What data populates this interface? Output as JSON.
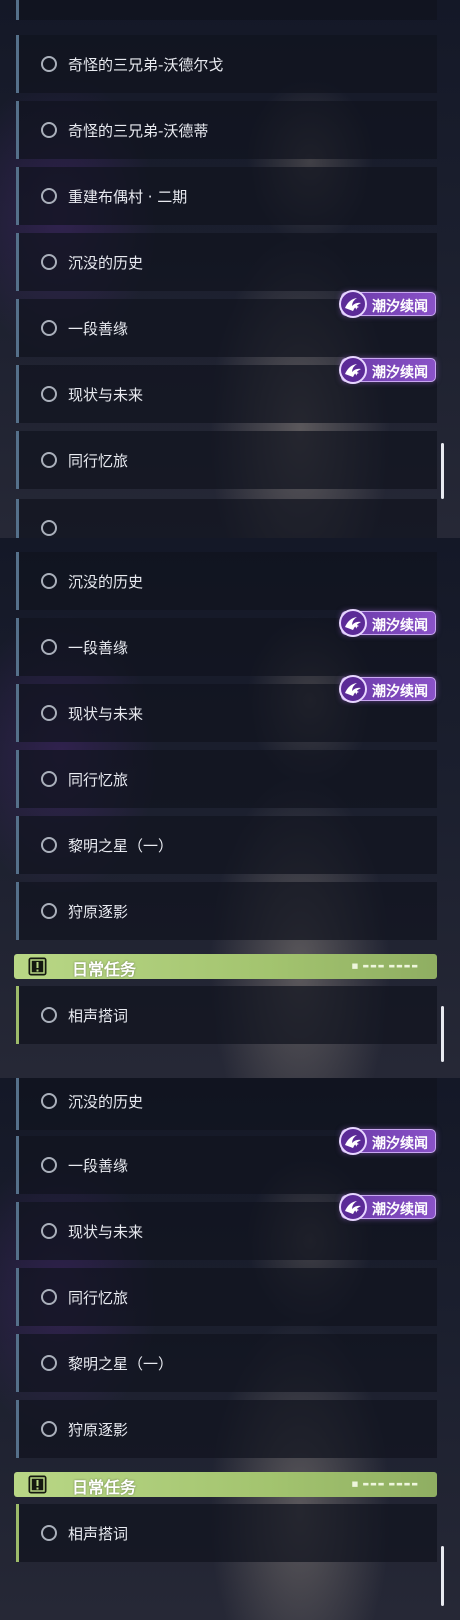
{
  "tag": {
    "label": "潮汐续闻"
  },
  "section": {
    "title": "日常任务"
  },
  "screen1": {
    "items": [
      "奇怪的三兄弟-沃德尔戈",
      "奇怪的三兄弟-沃德蒂",
      "重建布偶村 · 二期",
      "沉没的历史",
      "一段善缘",
      "现状与未来",
      "同行忆旅"
    ]
  },
  "screen2": {
    "items": [
      "沉没的历史",
      "一段善缘",
      "现状与未来",
      "同行忆旅",
      "黎明之星（一）",
      "狩原逐影"
    ],
    "daily": [
      "相声搭词"
    ]
  },
  "screen3": {
    "items": [
      "沉没的历史",
      "一段善缘",
      "现状与未来",
      "同行忆旅",
      "黎明之星（一）",
      "狩原逐影"
    ],
    "daily": [
      "相声搭词"
    ]
  },
  "colors": {
    "accent_blue": "#55708a",
    "daily_green": "#a3c46f",
    "tag_purple": "#7a46b8"
  }
}
